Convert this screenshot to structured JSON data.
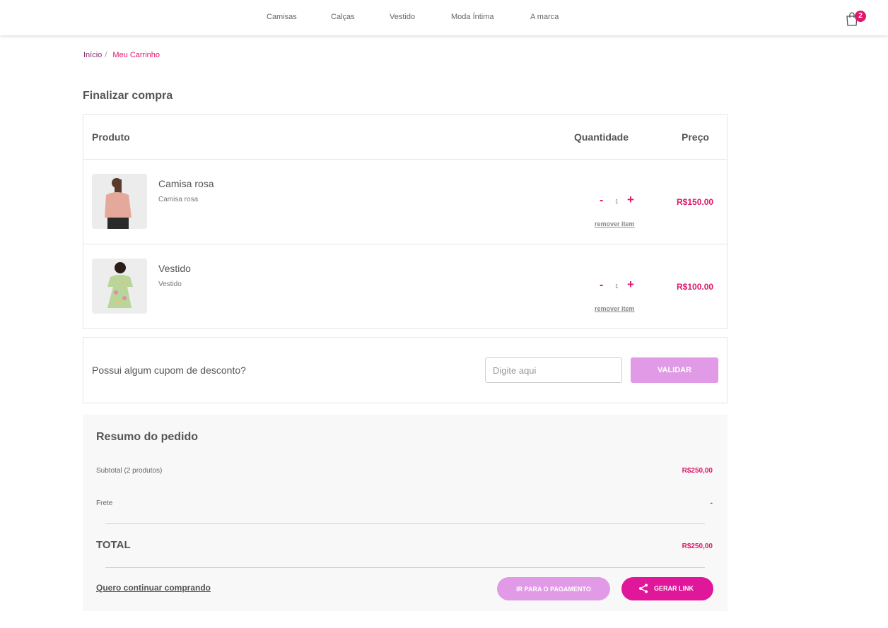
{
  "nav": {
    "items": [
      {
        "label": "Camisas"
      },
      {
        "label": "Calças"
      },
      {
        "label": "Vestido"
      },
      {
        "label": "Moda Íntima"
      },
      {
        "label": "A marca"
      }
    ],
    "cart_count": "2",
    "cart_icon": "shopping-bag-icon"
  },
  "breadcrumb": {
    "home": "Início",
    "separator": "/",
    "current": "Meu Carrinho"
  },
  "page": {
    "title": "Finalizar compra"
  },
  "cart": {
    "headers": {
      "product": "Produto",
      "quantity": "Quantidade",
      "price": "Preço"
    },
    "items": [
      {
        "name": "Camisa rosa",
        "description": "Camisa rosa",
        "quantity": "1",
        "minus": "-",
        "plus": "+",
        "remove": "remover item",
        "price": "R$150.00"
      },
      {
        "name": "Vestido",
        "description": "Vestido",
        "quantity": "1",
        "minus": "-",
        "plus": "+",
        "remove": "remover item",
        "price": "R$100.00"
      }
    ]
  },
  "coupon": {
    "label": "Possui algum cupom de desconto?",
    "placeholder": "Digite aqui",
    "button": "VALIDAR"
  },
  "summary": {
    "title": "Resumo do pedido",
    "subtotal_label": "Subtotal (2 produtos)",
    "subtotal_value": "R$250,00",
    "shipping_label": "Frete",
    "shipping_value": "-",
    "total_label": "TOTAL",
    "total_value": "R$250,00",
    "continue_link": "Quero continuar comprando",
    "pay_button": "IR PARA O PAGAMENTO",
    "share_button": "GERAR LINK"
  },
  "colors": {
    "accent": "#e0176b",
    "button_light": "#e19be6",
    "button_strong": "#e0179b"
  }
}
